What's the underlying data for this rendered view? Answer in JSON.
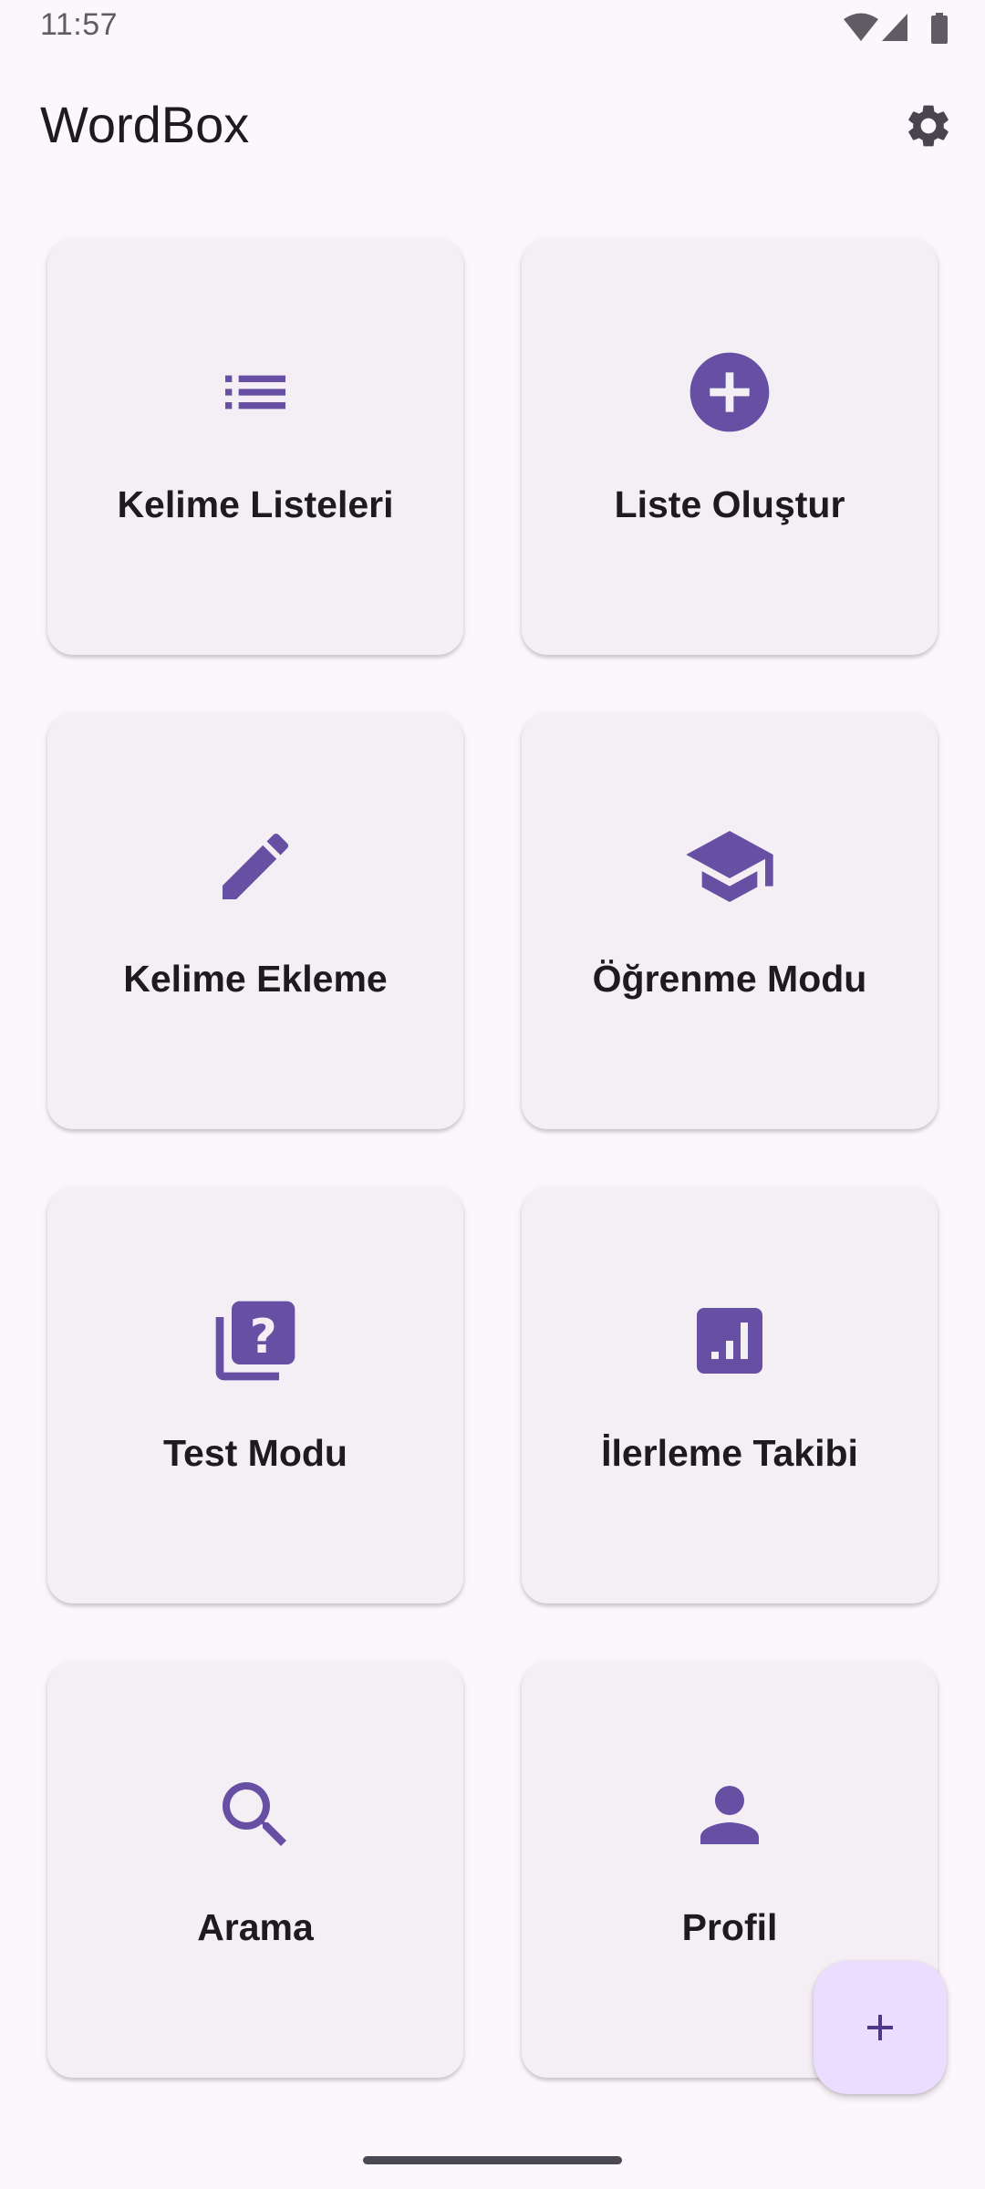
{
  "status_bar": {
    "time": "11:57",
    "icons": [
      "wifi-icon",
      "cell-signal-icon",
      "battery-icon"
    ]
  },
  "app_bar": {
    "title": "WordBox",
    "action_icon": "gear-icon"
  },
  "colors": {
    "background": "#FCF7FC",
    "card": "#F4EFF5",
    "accent": "#6750A4",
    "fab": "#EADDFF",
    "text": "#1D1B20"
  },
  "menu": [
    {
      "label": "Kelime Listeleri",
      "icon": "list-icon"
    },
    {
      "label": "Liste Oluştur",
      "icon": "add-circle-icon"
    },
    {
      "label": "Kelime Ekleme",
      "icon": "pencil-icon"
    },
    {
      "label": "Öğrenme Modu",
      "icon": "graduation-cap-icon"
    },
    {
      "label": "Test Modu",
      "icon": "quiz-icon"
    },
    {
      "label": "İlerleme Takibi",
      "icon": "bar-chart-icon"
    },
    {
      "label": "Arama",
      "icon": "search-icon"
    },
    {
      "label": "Profil",
      "icon": "person-icon"
    }
  ],
  "fab": {
    "icon": "plus-icon"
  }
}
